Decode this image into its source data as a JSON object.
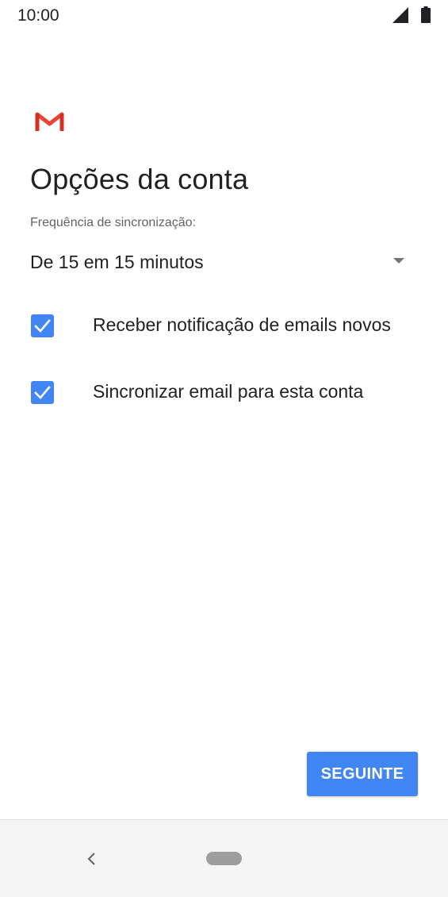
{
  "status_bar": {
    "time": "10:00",
    "icons": [
      "signal-icon",
      "battery-icon"
    ]
  },
  "app": {
    "logo": "gmail-logo",
    "colors": {
      "accent": "#4285f4",
      "gmail_red": "#ea4335"
    }
  },
  "page": {
    "title": "Opções da conta",
    "sync_label": "Frequência de sincronização:",
    "sync_value": "De 15 em 15 minutos"
  },
  "options": [
    {
      "label": "Receber notificação de emails novos",
      "checked": true
    },
    {
      "label": "Sincronizar email para esta conta",
      "checked": true
    }
  ],
  "footer": {
    "next_label": "SEGUINTE"
  },
  "nav_bar": {
    "icons": [
      "back-icon",
      "home-pill"
    ]
  }
}
